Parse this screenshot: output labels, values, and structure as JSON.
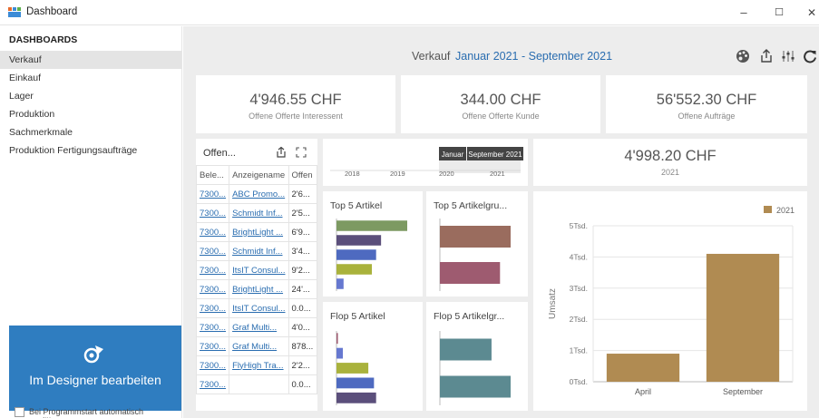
{
  "window": {
    "title": "Dashboard",
    "minimize": "–",
    "maximize": "☐",
    "close": "✕"
  },
  "sidebar": {
    "heading": "DASHBOARDS",
    "items": [
      {
        "label": "Verkauf"
      },
      {
        "label": "Einkauf"
      },
      {
        "label": "Lager"
      },
      {
        "label": "Produktion"
      },
      {
        "label": "Sachmerkmale"
      },
      {
        "label": "Produktion Fertigungsaufträge"
      }
    ],
    "designer_button": "Im Designer bearbeiten",
    "autostart_label": "Bei Programmstart automatisch ausführen"
  },
  "header": {
    "name": "Verkauf",
    "range": "Januar 2021 - September 2021"
  },
  "kpis": [
    {
      "value": "4'946.55 CHF",
      "label": "Offene Offerte Interessent"
    },
    {
      "value": "344.00 CHF",
      "label": "Offene Offerte Kunde"
    },
    {
      "value": "56'552.30 CHF",
      "label": "Offene Aufträge"
    }
  ],
  "offers": {
    "title": "Offen...",
    "columns": [
      "Bele...",
      "Anzeigename",
      "Offen"
    ],
    "rows": [
      [
        "7300...",
        "ABC Promo...",
        "2'6..."
      ],
      [
        "7300...",
        "Schmidt Inf...",
        "2'5..."
      ],
      [
        "7300...",
        "BrightLight ...",
        "6'9..."
      ],
      [
        "7300...",
        "Schmidt Inf...",
        "3'4..."
      ],
      [
        "7300...",
        "ItsIT Consul...",
        "9'2..."
      ],
      [
        "7300...",
        "BrightLight ...",
        "24'..."
      ],
      [
        "7300...",
        "ItsIT Consul...",
        "0.0..."
      ],
      [
        "7300...",
        "Graf Multi...",
        "4'0..."
      ],
      [
        "7300...",
        "Graf Multi...",
        "878..."
      ],
      [
        "7300...",
        "FlyHigh Tra...",
        "2'2..."
      ],
      [
        "7300...",
        "",
        "0.0..."
      ]
    ]
  },
  "timeline": {
    "years": [
      "2018",
      "2019",
      "2020",
      "2021"
    ],
    "tooltip_left": "Januar",
    "tooltip_right": "September 2021"
  },
  "total_2021": {
    "value": "4'998.20 CHF",
    "label": "2021"
  },
  "mini_charts": [
    {
      "title": "Top 5 Artikel"
    },
    {
      "title": "Top 5 Artikelgru..."
    },
    {
      "title": "Flop 5 Artikel"
    },
    {
      "title": "Flop 5 Artikelgr..."
    }
  ],
  "chart_data": [
    {
      "type": "bar",
      "title": "Top 5 Artikel",
      "orientation": "horizontal",
      "values": [
        1.0,
        0.63,
        0.56,
        0.5,
        0.1
      ],
      "colors": [
        "#7d9a62",
        "#5b4f7b",
        "#4e6ac0",
        "#a9b23c",
        "#6678d0"
      ]
    },
    {
      "type": "bar",
      "title": "Top 5 Artikelgru...",
      "orientation": "horizontal",
      "values": [
        1.0,
        0.85
      ],
      "colors": [
        "#9a6c5e",
        "#9e5b70"
      ]
    },
    {
      "type": "bar",
      "title": "Flop 5 Artikel",
      "orientation": "horizontal",
      "values": [
        0.02,
        0.09,
        0.45,
        0.53,
        0.56
      ],
      "colors": [
        "#9e5b70",
        "#6678d0",
        "#a9b23c",
        "#4e6ac0",
        "#5b4f7b"
      ]
    },
    {
      "type": "bar",
      "title": "Flop 5 Artikelgr...",
      "orientation": "horizontal",
      "values": [
        0.73,
        1.0
      ],
      "colors": [
        "#5c8a91",
        "#5c8a91"
      ]
    },
    {
      "type": "bar",
      "categories": [
        "April",
        "September"
      ],
      "series": [
        {
          "name": "2021",
          "values": [
            900,
            4100
          ]
        }
      ],
      "ylabel": "Umsatz",
      "yticks": [
        "0Tsd.",
        "1Tsd.",
        "2Tsd.",
        "3Tsd.",
        "4Tsd.",
        "5Tsd."
      ],
      "ylim": [
        0,
        5000
      ],
      "legend": "top-right",
      "grid": true,
      "color": "#b08b52"
    }
  ],
  "colors": {
    "accent": "#2a6db0",
    "designer": "#2f7dc0",
    "background": "#ededed"
  },
  "icons": [
    "dashboard-app-icon",
    "palette-icon",
    "export-icon",
    "filter-settings-icon",
    "refresh-icon",
    "expand-icon",
    "designer-icon"
  ]
}
